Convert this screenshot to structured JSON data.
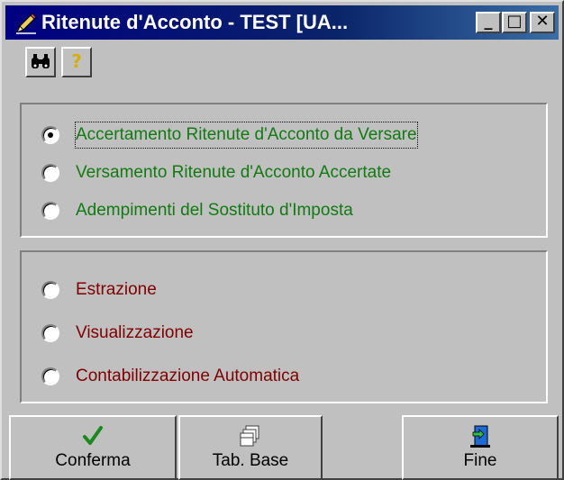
{
  "window": {
    "title": "Ritenute d'Acconto - TEST [UA...",
    "controls": {
      "minimize": "_",
      "maximize": "□",
      "close": "✕"
    }
  },
  "toolbar": {
    "find_icon": "binoculars-icon",
    "help_icon": "question-mark-icon",
    "help_glyph": "?"
  },
  "group1": {
    "options": [
      {
        "label": "Accertamento Ritenute d'Acconto da Versare",
        "selected": true
      },
      {
        "label": "Versamento Ritenute d'Acconto Accertate",
        "selected": false
      },
      {
        "label": "Adempimenti del Sostituto d'Imposta",
        "selected": false
      }
    ]
  },
  "group2": {
    "options": [
      {
        "label": "Estrazione",
        "selected": false
      },
      {
        "label": "Visualizzazione",
        "selected": false
      },
      {
        "label": "Contabilizzazione Automatica",
        "selected": false
      }
    ]
  },
  "buttons": {
    "conferma": {
      "label": "Conferma",
      "icon": "checkmark-icon"
    },
    "tab_base": {
      "label": "Tab. Base",
      "icon": "table-icon"
    },
    "fine": {
      "label": "Fine",
      "icon": "exit-door-icon"
    }
  },
  "colors": {
    "title_bar": "#000080",
    "group1_text": "#117a11",
    "group2_text": "#800000",
    "face": "#c0c0c0"
  }
}
